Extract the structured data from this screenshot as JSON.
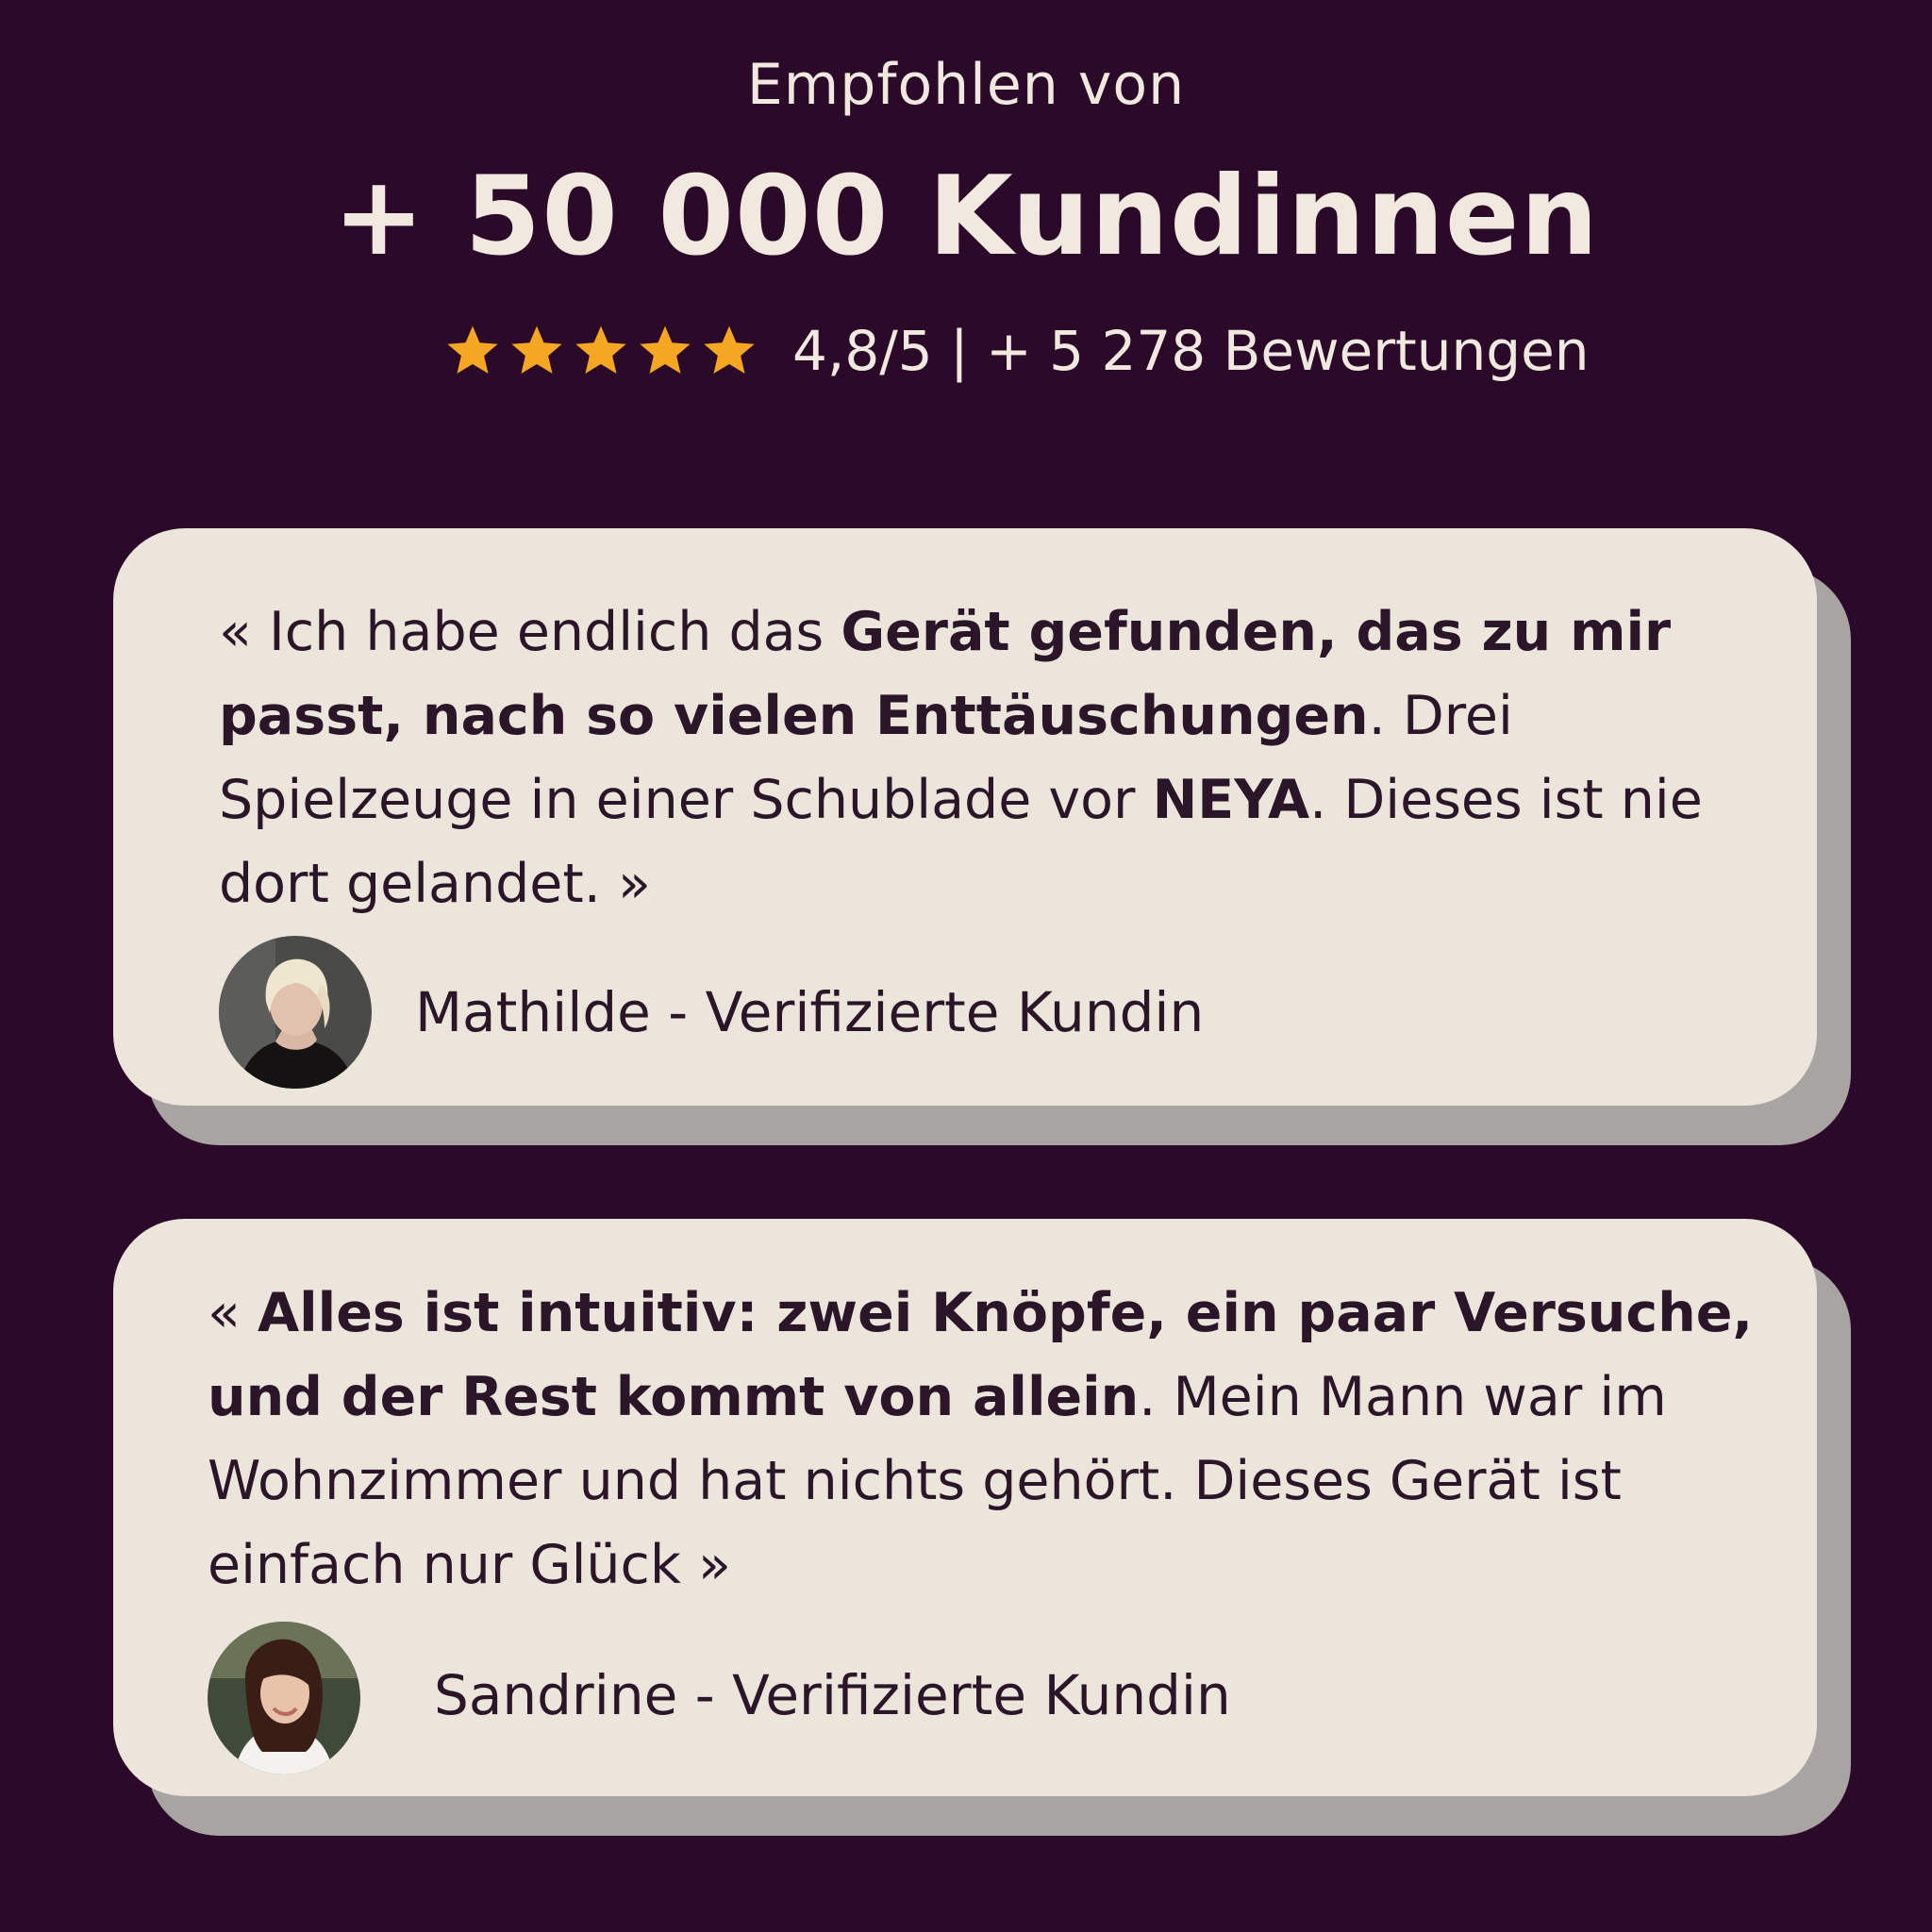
{
  "header": {
    "eyebrow": "Empfohlen von",
    "headline": "+ 50 000 Kundinnen",
    "rating_text": "4,8/5 | + 5 278 Bewertungen",
    "stars": 5,
    "star_color": "#f5a623"
  },
  "colors": {
    "background": "#2a0a28",
    "card": "#ebe5dc",
    "card_shadow": "#a8a4a2",
    "text_dark": "#2a1628",
    "text_light": "#f1e9df"
  },
  "reviews": [
    {
      "open_quote": "« ",
      "segments": [
        {
          "text": "Ich habe endlich das ",
          "bold": false
        },
        {
          "text": "Gerät gefunden, das zu mir passt, nach so vielen Enttäuschungen",
          "bold": true
        },
        {
          "text": ". Drei Spielzeuge in einer Schublade vor ",
          "bold": false
        },
        {
          "text": "NEYA",
          "bold": true
        },
        {
          "text": ". Dieses ist nie dort gelandet.",
          "bold": false
        }
      ],
      "close_quote": " »",
      "author": "Mathilde - Verifizierte Kundin",
      "avatar_icon": "woman-blonde-portrait-icon"
    },
    {
      "open_quote": "« ",
      "segments": [
        {
          "text": "Alles ist intuitiv: zwei Knöpfe, ein paar Versuche, und der Rest kommt von allein",
          "bold": true
        },
        {
          "text": ". Mein Mann war im Wohnzimmer und hat nichts gehört. Dieses Gerät ist einfach nur Glück",
          "bold": false
        }
      ],
      "close_quote": " »",
      "author": "Sandrine - Verifizierte Kundin",
      "avatar_icon": "woman-brunette-portrait-icon"
    }
  ]
}
